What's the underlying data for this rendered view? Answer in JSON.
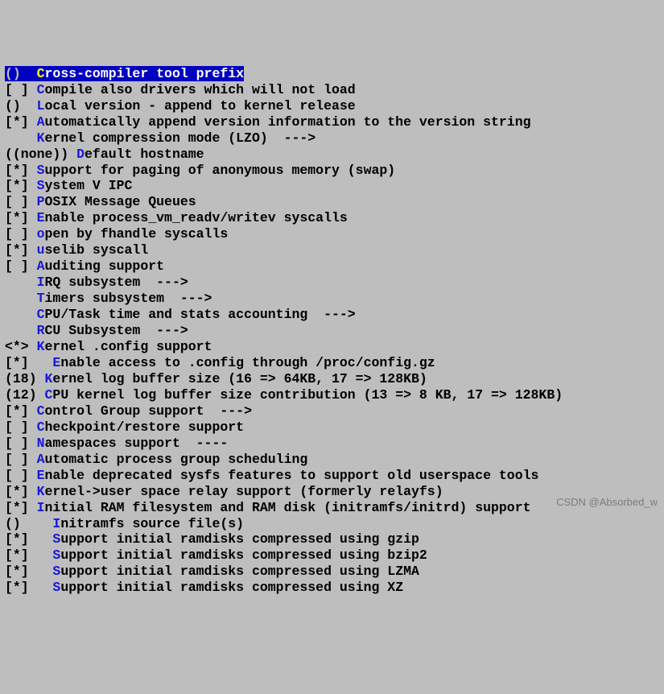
{
  "watermark": "CSDN @Absorbed_w",
  "menu": {
    "items": [
      {
        "bracket": "()  ",
        "hotkey": "C",
        "label": "ross-compiler tool prefix",
        "arrow": "",
        "selected": true,
        "indent": 0
      },
      {
        "bracket": "[ ] ",
        "hotkey": "C",
        "label": "ompile also drivers which will not load",
        "arrow": "",
        "selected": false,
        "indent": 0
      },
      {
        "bracket": "()  ",
        "hotkey": "L",
        "label": "ocal version - append to kernel release",
        "arrow": "",
        "selected": false,
        "indent": 0
      },
      {
        "bracket": "[*] ",
        "hotkey": "A",
        "label": "utomatically append version information to the version string",
        "arrow": "",
        "selected": false,
        "indent": 0
      },
      {
        "bracket": "    ",
        "hotkey": "K",
        "label": "ernel compression mode (LZO)  ",
        "arrow": "--->",
        "selected": false,
        "indent": 0
      },
      {
        "bracket": "((none)) ",
        "hotkey": "D",
        "label": "efault hostname",
        "arrow": "",
        "selected": false,
        "indent": 0
      },
      {
        "bracket": "[*] ",
        "hotkey": "S",
        "label": "upport for paging of anonymous memory (swap)",
        "arrow": "",
        "selected": false,
        "indent": 0
      },
      {
        "bracket": "[*] ",
        "hotkey": "S",
        "label": "ystem V IPC",
        "arrow": "",
        "selected": false,
        "indent": 0
      },
      {
        "bracket": "[ ] ",
        "hotkey": "P",
        "label": "OSIX Message Queues",
        "arrow": "",
        "selected": false,
        "indent": 0
      },
      {
        "bracket": "[*] ",
        "hotkey": "E",
        "label": "nable process_vm_readv/writev syscalls",
        "arrow": "",
        "selected": false,
        "indent": 0
      },
      {
        "bracket": "[ ] ",
        "hotkey": "o",
        "label": "pen by fhandle syscalls",
        "arrow": "",
        "selected": false,
        "indent": 0
      },
      {
        "bracket": "[*] ",
        "hotkey": "u",
        "label": "selib syscall",
        "arrow": "",
        "selected": false,
        "indent": 0
      },
      {
        "bracket": "[ ] ",
        "hotkey": "A",
        "label": "uditing support",
        "arrow": "",
        "selected": false,
        "indent": 0
      },
      {
        "bracket": "    ",
        "hotkey": "I",
        "label": "RQ subsystem  ",
        "arrow": "--->",
        "selected": false,
        "indent": 0
      },
      {
        "bracket": "    ",
        "hotkey": "T",
        "label": "imers subsystem  ",
        "arrow": "--->",
        "selected": false,
        "indent": 0
      },
      {
        "bracket": "    ",
        "hotkey": "C",
        "label": "PU/Task time and stats accounting  ",
        "arrow": "--->",
        "selected": false,
        "indent": 0
      },
      {
        "bracket": "    ",
        "hotkey": "R",
        "label": "CU Subsystem  ",
        "arrow": "--->",
        "selected": false,
        "indent": 0
      },
      {
        "bracket": "<*> ",
        "hotkey": "K",
        "label": "ernel .config support",
        "arrow": "",
        "selected": false,
        "indent": 0
      },
      {
        "bracket": "[*]   ",
        "hotkey": "E",
        "label": "nable access to .config through /proc/config.gz",
        "arrow": "",
        "selected": false,
        "indent": 0
      },
      {
        "bracket": "(18) ",
        "hotkey": "K",
        "label": "ernel log buffer size (16 => 64KB, 17 => 128KB)",
        "arrow": "",
        "selected": false,
        "indent": 0
      },
      {
        "bracket": "(12) ",
        "hotkey": "C",
        "label": "PU kernel log buffer size contribution (13 => 8 KB, 17 => 128KB)",
        "arrow": "",
        "selected": false,
        "indent": 0
      },
      {
        "bracket": "[*] ",
        "hotkey": "C",
        "label": "ontrol Group support  ",
        "arrow": "--->",
        "selected": false,
        "indent": 0
      },
      {
        "bracket": "[ ] ",
        "hotkey": "C",
        "label": "heckpoint/restore support",
        "arrow": "",
        "selected": false,
        "indent": 0
      },
      {
        "bracket": "[ ] ",
        "hotkey": "N",
        "label": "amespaces support  ",
        "arrow": "----",
        "selected": false,
        "indent": 0
      },
      {
        "bracket": "[ ] ",
        "hotkey": "A",
        "label": "utomatic process group scheduling",
        "arrow": "",
        "selected": false,
        "indent": 0
      },
      {
        "bracket": "[ ] ",
        "hotkey": "E",
        "label": "nable deprecated sysfs features to support old userspace tools",
        "arrow": "",
        "selected": false,
        "indent": 0
      },
      {
        "bracket": "[*] ",
        "hotkey": "K",
        "label": "ernel->user space relay support (formerly relayfs)",
        "arrow": "",
        "selected": false,
        "indent": 0
      },
      {
        "bracket": "[*] ",
        "hotkey": "I",
        "label": "nitial RAM filesystem and RAM disk (initramfs/initrd) support",
        "arrow": "",
        "selected": false,
        "indent": 0
      },
      {
        "bracket": "()    ",
        "hotkey": "I",
        "label": "nitramfs source file(s)",
        "arrow": "",
        "selected": false,
        "indent": 0
      },
      {
        "bracket": "[*]   ",
        "hotkey": "S",
        "label": "upport initial ramdisks compressed using gzip",
        "arrow": "",
        "selected": false,
        "indent": 0
      },
      {
        "bracket": "[*]   ",
        "hotkey": "S",
        "label": "upport initial ramdisks compressed using bzip2",
        "arrow": "",
        "selected": false,
        "indent": 0
      },
      {
        "bracket": "[*]   ",
        "hotkey": "S",
        "label": "upport initial ramdisks compressed using LZMA",
        "arrow": "",
        "selected": false,
        "indent": 0
      },
      {
        "bracket": "[*]   ",
        "hotkey": "S",
        "label": "upport initial ramdisks compressed using XZ",
        "arrow": "",
        "selected": false,
        "indent": 0
      }
    ]
  }
}
